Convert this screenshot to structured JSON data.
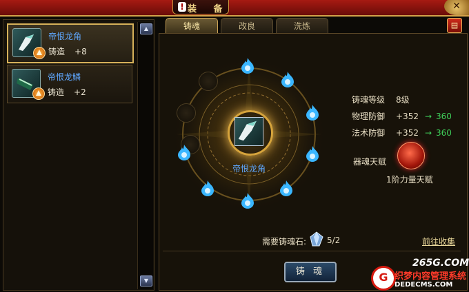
{
  "window": {
    "title": "装 备",
    "accent": "#a61a12",
    "gold": "#d4a24a"
  },
  "items": [
    {
      "name": "帝恨龙角",
      "stat": "铸造",
      "bonus": "+8",
      "selected": true
    },
    {
      "name": "帝恨龙鳞",
      "stat": "铸造",
      "bonus": "+2",
      "selected": false
    }
  ],
  "tabs": [
    {
      "label": "铸魂",
      "active": true
    },
    {
      "label": "改良",
      "active": false
    },
    {
      "label": "洗炼",
      "active": false
    }
  ],
  "center_item": {
    "name": "帝恨龙角"
  },
  "soul_slots": {
    "filled": 8,
    "total": 11
  },
  "stats": [
    {
      "label": "铸魂等级",
      "value": "8级"
    },
    {
      "label": "物理防御",
      "value": "+352",
      "arrow": "→",
      "new": "360"
    },
    {
      "label": "法术防御",
      "value": "+352",
      "arrow": "→",
      "new": "360"
    }
  ],
  "talent": {
    "label": "器魂天赋",
    "name": "1阶力量天赋"
  },
  "requirement": {
    "label": "需要铸魂石:",
    "count": "5/2",
    "collect_link": "前往收集"
  },
  "forge_button": "铸 魂",
  "watermark": {
    "site": "265G.COM",
    "text": "织梦内容管理系统",
    "url": "DEDECMS.COM",
    "logo": "G"
  }
}
